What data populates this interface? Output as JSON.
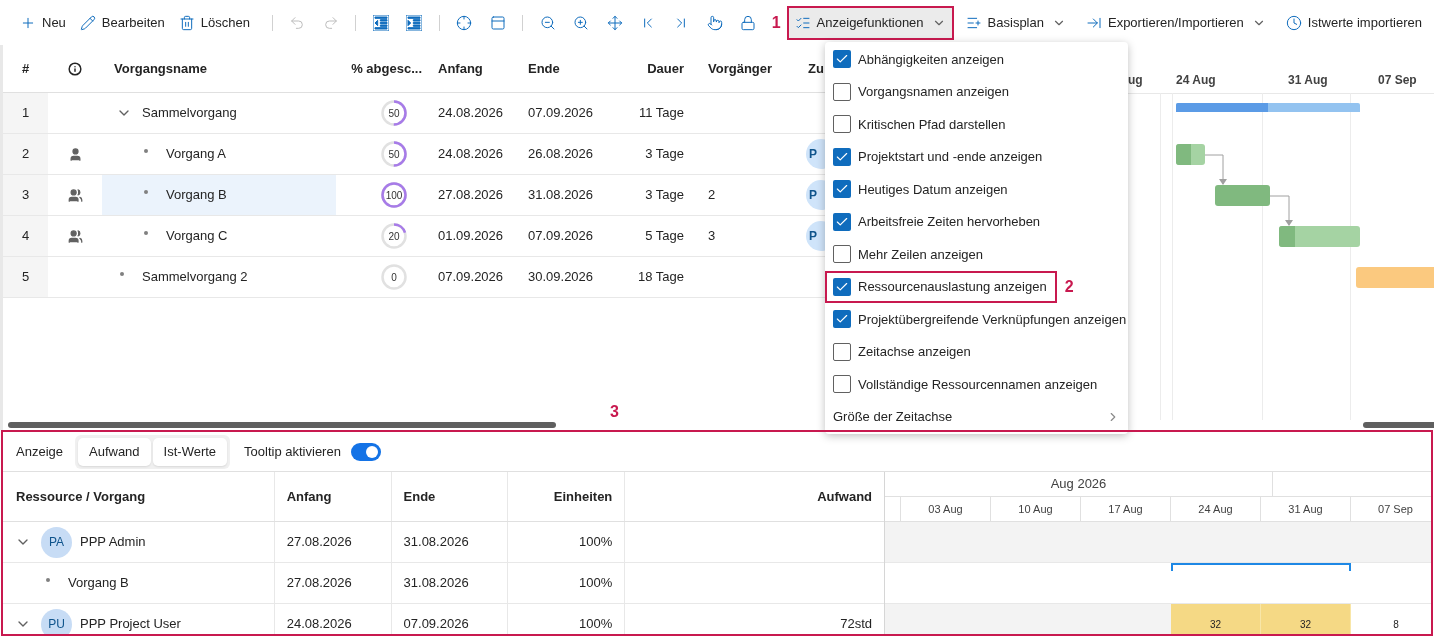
{
  "toolbar": {
    "actions": [
      {
        "label": "Neu"
      },
      {
        "label": "Bearbeiten"
      },
      {
        "label": "Löschen"
      }
    ],
    "icon_buttons": [
      {
        "disabled": true
      },
      {
        "disabled": true
      },
      {
        "disabled": false
      },
      {
        "disabled": false
      },
      {
        "disabled": false
      },
      {
        "disabled": false
      },
      {
        "disabled": false
      },
      {
        "disabled": false
      },
      {
        "disabled": false
      },
      {
        "disabled": false
      },
      {
        "disabled": false
      },
      {
        "disabled": false
      },
      {
        "disabled": false
      }
    ],
    "menus": [
      {
        "label": "Anzeigefunktionen",
        "dropdown": true,
        "expanded": true,
        "callout": "1"
      },
      {
        "label": "Basisplan",
        "dropdown": true,
        "expanded": false
      },
      {
        "label": "Exportieren/Importieren",
        "dropdown": true,
        "expanded": false
      },
      {
        "label": "Istwerte importieren",
        "dropdown": false,
        "expanded": false
      }
    ]
  },
  "task_table": {
    "columns": [
      "#",
      "Vorgangsname",
      "% abgesc...",
      "Anfang",
      "Ende",
      "Dauer",
      "Vorgänger",
      "Zu"
    ],
    "rows": [
      {
        "id": "1",
        "name": "Sammelvorgang",
        "level": 0.5,
        "percent": "50",
        "start": "24.08.2026",
        "end": "07.09.2026",
        "duration": "11 Tage",
        "selected": false,
        "expanded": true,
        "children": [
          {
            "id": "2",
            "name": "Vorgang A",
            "level": 0.5,
            "percent": "50",
            "start": "24.08.2026",
            "end": "26.08.2026",
            "duration": "3 Tage",
            "selected": false,
            "kind": "person",
            "assigned": "P"
          },
          {
            "id": "3",
            "name": "Vorgang B",
            "level": 1,
            "percent": "100",
            "start": "27.08.2026",
            "end": "31.08.2026",
            "duration": "3 Tage",
            "predecessor": "2",
            "selected": true,
            "kind": "group",
            "assigned": "P"
          },
          {
            "id": "4",
            "name": "Vorgang C",
            "level": 0.2,
            "percent": "20",
            "start": "01.09.2026",
            "end": "07.09.2026",
            "duration": "5 Tage",
            "predecessor": "3",
            "selected": false,
            "kind": "group",
            "assigned": "P"
          }
        ]
      },
      {
        "id": "5",
        "name": "Sammelvorgang 2",
        "level": 0,
        "percent": "0",
        "start": "07.09.2026",
        "end": "30.09.2026",
        "duration": "18 Tage",
        "selected": false
      }
    ]
  },
  "gantt": {
    "weeks": [
      "ug",
      "24 Aug",
      "31 Aug",
      "07 Sep"
    ]
  },
  "display_menu": {
    "items": [
      {
        "kind": "checkbox",
        "label": "Abhängigkeiten anzeigen",
        "checked": true
      },
      {
        "kind": "checkbox",
        "label": "Vorgangsnamen anzeigen",
        "checked": false
      },
      {
        "kind": "checkbox",
        "label": "Kritischen Pfad darstellen",
        "checked": false
      },
      {
        "kind": "checkbox",
        "label": "Projektstart und -ende anzeigen",
        "checked": true
      },
      {
        "kind": "checkbox",
        "label": "Heutiges Datum anzeigen",
        "checked": true
      },
      {
        "kind": "checkbox",
        "label": "Arbeitsfreie Zeiten hervorheben",
        "checked": true
      },
      {
        "kind": "checkbox",
        "label": "Mehr Zeilen anzeigen",
        "checked": false
      },
      {
        "kind": "checkbox",
        "label": "Ressourcenauslastung anzeigen",
        "checked": true,
        "callout": "2"
      },
      {
        "kind": "checkbox",
        "label": "Projektübergreifende Verknüpfungen anzeigen",
        "checked": true
      },
      {
        "kind": "checkbox",
        "label": "Zeitachse anzeigen",
        "checked": false
      },
      {
        "kind": "checkbox",
        "label": "Vollständige Ressourcennamen anzeigen",
        "checked": false
      },
      {
        "kind": "submenu",
        "label": "Größe der Zeitachse"
      }
    ]
  },
  "resource_panel": {
    "callout": "3",
    "display_label": "Anzeige",
    "views": [
      "Aufwand",
      "Ist-Werte"
    ],
    "tooltip": {
      "label": "Tooltip aktivieren",
      "on": true
    },
    "columns": [
      "Ressource / Vorgang",
      "Anfang",
      "Ende",
      "Einheiten",
      "Aufwand"
    ],
    "month": "Aug 2026",
    "weeks": [
      "03 Aug",
      "10 Aug",
      "17 Aug",
      "24 Aug",
      "31 Aug",
      "07 Sep"
    ],
    "rows": [
      {
        "kind": "resource",
        "initials": "PA",
        "name": "PPP Admin",
        "start": "27.08.2026",
        "end": "31.08.2026",
        "units": "100%",
        "expanded": true,
        "cells": [
          {
            "kind": "idle"
          },
          {
            "kind": "idle"
          },
          {
            "kind": "idle"
          },
          {
            "kind": "idle"
          },
          {
            "kind": "idle"
          },
          {
            "kind": "idle"
          }
        ]
      },
      {
        "kind": "task",
        "name": "Vorgang B",
        "start": "27.08.2026",
        "end": "31.08.2026",
        "units": "100%",
        "cells": [
          {
            "kind": "blank"
          },
          {
            "kind": "blank"
          },
          {
            "kind": "blank"
          },
          {
            "kind": "span"
          },
          {
            "kind": "span"
          },
          {
            "kind": "blank"
          }
        ]
      },
      {
        "kind": "resource",
        "initials": "PU",
        "name": "PPP Project User",
        "start": "24.08.2026",
        "end": "07.09.2026",
        "units": "100%",
        "effort": "72std",
        "expanded": true,
        "cells": [
          {
            "kind": "idle"
          },
          {
            "kind": "idle"
          },
          {
            "kind": "idle"
          },
          {
            "kind": "over",
            "text": "32"
          },
          {
            "kind": "over",
            "text": "32"
          },
          {
            "kind": "load",
            "text": "8"
          }
        ]
      }
    ]
  }
}
